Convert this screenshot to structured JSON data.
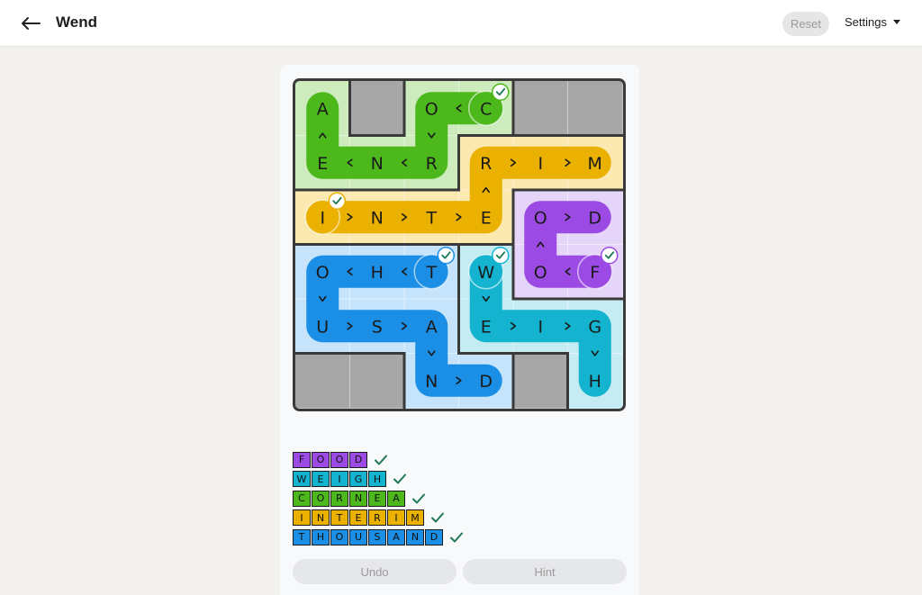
{
  "header": {
    "title": "Wend",
    "reset_label": "Reset",
    "settings_label": "Settings"
  },
  "colors": {
    "food": "#9b4be3",
    "weigh": "#14b3cf",
    "cornea": "#4cb81c",
    "interim": "#eab100",
    "thousand": "#1b8ee6",
    "region_food": "#e5d6f9",
    "region_weigh": "#c4ecf2",
    "region_cornea": "#cdebbd",
    "region_interim": "#fbe9b0",
    "region_thousand": "#c5e3fb",
    "blocked": "#a7a7a7",
    "border": "#3a3a3a",
    "check": "#1f7a55"
  },
  "board": {
    "rows": 6,
    "cols": 6,
    "cells": [
      [
        "A",
        "",
        "O",
        "C",
        "",
        ""
      ],
      [
        "E",
        "N",
        "R",
        "R",
        "I",
        "M"
      ],
      [
        "I",
        "N",
        "T",
        "E",
        "O",
        "D"
      ],
      [
        "O",
        "H",
        "T",
        "W",
        "O",
        "F"
      ],
      [
        "U",
        "S",
        "A",
        "E",
        "I",
        "G"
      ],
      [
        "",
        "",
        "N",
        "D",
        "",
        "H"
      ]
    ],
    "regions": [
      [
        "cornea",
        "blocked",
        "cornea",
        "cornea",
        "blocked",
        "blocked"
      ],
      [
        "cornea",
        "cornea",
        "cornea",
        "interim",
        "interim",
        "interim"
      ],
      [
        "interim",
        "interim",
        "interim",
        "interim",
        "food",
        "food"
      ],
      [
        "thousand",
        "thousand",
        "thousand",
        "weigh",
        "food",
        "food"
      ],
      [
        "thousand",
        "thousand",
        "thousand",
        "weigh",
        "weigh",
        "weigh"
      ],
      [
        "blocked",
        "blocked",
        "thousand",
        "thousand",
        "blocked",
        "weigh"
      ]
    ],
    "paths": [
      {
        "word": "cornea",
        "cells": [
          [
            0,
            3
          ],
          [
            0,
            2
          ],
          [
            1,
            2
          ],
          [
            1,
            1
          ],
          [
            1,
            0
          ],
          [
            0,
            0
          ]
        ],
        "start": [
          0,
          3
        ],
        "check": [
          0,
          3
        ]
      },
      {
        "word": "interim",
        "cells": [
          [
            2,
            0
          ],
          [
            2,
            1
          ],
          [
            2,
            2
          ],
          [
            2,
            3
          ],
          [
            1,
            3
          ],
          [
            1,
            4
          ],
          [
            1,
            5
          ]
        ],
        "start": [
          2,
          0
        ],
        "check": [
          2,
          0
        ]
      },
      {
        "word": "food",
        "cells": [
          [
            3,
            5
          ],
          [
            3,
            4
          ],
          [
            2,
            4
          ],
          [
            2,
            5
          ]
        ],
        "start": [
          3,
          5
        ],
        "check": [
          3,
          5
        ]
      },
      {
        "word": "thousand",
        "cells": [
          [
            3,
            2
          ],
          [
            3,
            1
          ],
          [
            3,
            0
          ],
          [
            4,
            0
          ],
          [
            4,
            1
          ],
          [
            4,
            2
          ],
          [
            5,
            2
          ],
          [
            5,
            3
          ]
        ],
        "start": [
          3,
          2
        ],
        "check": [
          3,
          2
        ]
      },
      {
        "word": "weigh",
        "cells": [
          [
            3,
            3
          ],
          [
            4,
            3
          ],
          [
            4,
            4
          ],
          [
            4,
            5
          ],
          [
            5,
            5
          ]
        ],
        "start": [
          3,
          3
        ],
        "check": [
          3,
          3
        ]
      }
    ]
  },
  "found_words": [
    {
      "word": "food",
      "letters": [
        "F",
        "O",
        "O",
        "D"
      ]
    },
    {
      "word": "weigh",
      "letters": [
        "W",
        "E",
        "I",
        "G",
        "H"
      ]
    },
    {
      "word": "cornea",
      "letters": [
        "C",
        "O",
        "R",
        "N",
        "E",
        "A"
      ]
    },
    {
      "word": "interim",
      "letters": [
        "I",
        "N",
        "T",
        "E",
        "R",
        "I",
        "M"
      ]
    },
    {
      "word": "thousand",
      "letters": [
        "T",
        "H",
        "O",
        "U",
        "S",
        "A",
        "N",
        "D"
      ]
    }
  ],
  "buttons": {
    "undo_label": "Undo",
    "hint_label": "Hint"
  }
}
